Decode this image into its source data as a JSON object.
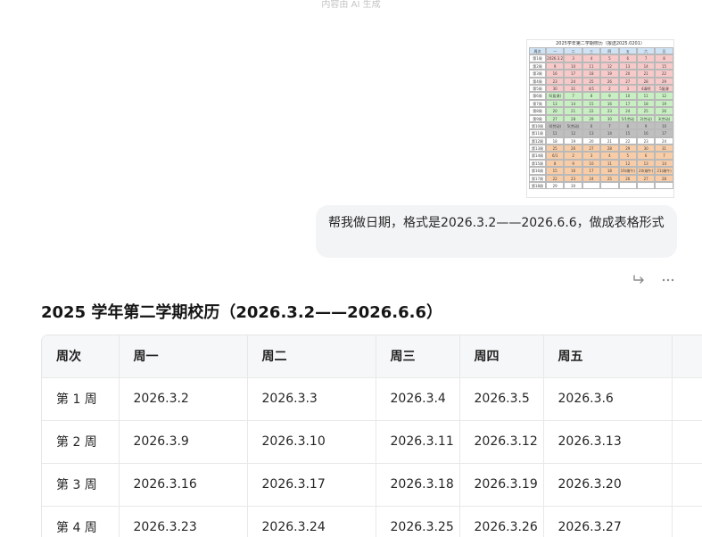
{
  "ai_note": "内容由 AI 生成",
  "thumbnail": {
    "title": "2025学年第二学期校历（报送2025.0201）",
    "header": [
      "周次",
      "一",
      "二",
      "三",
      "四",
      "五",
      "六",
      "日"
    ],
    "rows": [
      [
        "第1周",
        "2026.3.2",
        "3",
        "4",
        "5",
        "6",
        "7",
        "8"
      ],
      [
        "第2周",
        "9",
        "10",
        "11",
        "12",
        "13",
        "14",
        "15"
      ],
      [
        "第3周",
        "16",
        "17",
        "18",
        "19",
        "20",
        "21",
        "22"
      ],
      [
        "第4周",
        "23",
        "24",
        "25",
        "26",
        "27",
        "28",
        "29"
      ],
      [
        "第5周",
        "30",
        "31",
        "4/1",
        "2",
        "3",
        "4清明",
        "5复课"
      ],
      [
        "第6周",
        "6(复课)",
        "7",
        "8",
        "9",
        "10",
        "11",
        "12"
      ],
      [
        "第7周",
        "13",
        "14",
        "15",
        "16",
        "17",
        "18",
        "19"
      ],
      [
        "第8周",
        "20",
        "21",
        "22",
        "23",
        "24",
        "25",
        "26"
      ],
      [
        "第9周",
        "27",
        "28",
        "29",
        "30",
        "5/1劳动",
        "2(劳动)",
        "3(劳动)"
      ],
      [
        "第10周",
        "4(劳动)",
        "5(劳动)",
        "6",
        "7",
        "8",
        "9",
        "10"
      ],
      [
        "第11周",
        "11",
        "12",
        "13",
        "14",
        "15",
        "16",
        "17"
      ],
      [
        "第12周",
        "18",
        "19",
        "20",
        "21",
        "22",
        "23",
        "24"
      ],
      [
        "第13周",
        "25",
        "26",
        "27",
        "28",
        "29",
        "30",
        "31"
      ],
      [
        "第14周",
        "6/1",
        "2",
        "3",
        "4",
        "5",
        "6",
        "7"
      ],
      [
        "第15周",
        "8",
        "9",
        "10",
        "11",
        "12",
        "13",
        "14"
      ],
      [
        "第16周",
        "15",
        "16",
        "17",
        "18",
        "19(端午)",
        "20(端午)",
        "21(端午)"
      ],
      [
        "第17周",
        "22",
        "23",
        "24",
        "25",
        "26",
        "27",
        "28"
      ],
      [
        "第18周",
        "29",
        "30",
        "",
        "",
        "",
        "",
        ""
      ]
    ]
  },
  "user_message": "帮我做日期，格式是2026.3.2——2026.6.6，做成表格形式",
  "answer_title": "2025 学年第二学期校历（2026.3.2——2026.6.6）",
  "table": {
    "headers": [
      "周次",
      "周一",
      "周二",
      "周三",
      "周四",
      "周五",
      ""
    ],
    "rows": [
      [
        "第 1 周",
        "2026.3.2",
        "2026.3.3",
        "2026.3.4",
        "2026.3.5",
        "2026.3.6",
        ""
      ],
      [
        "第 2 周",
        "2026.3.9",
        "2026.3.10",
        "2026.3.11",
        "2026.3.12",
        "2026.3.13",
        ""
      ],
      [
        "第 3 周",
        "2026.3.16",
        "2026.3.17",
        "2026.3.18",
        "2026.3.19",
        "2026.3.20",
        ""
      ],
      [
        "第 4 周",
        "2026.3.23",
        "2026.3.24",
        "2026.3.25",
        "2026.3.26",
        "2026.3.27",
        ""
      ]
    ]
  },
  "icons": {
    "share": "share-icon",
    "more": "more-icon"
  }
}
